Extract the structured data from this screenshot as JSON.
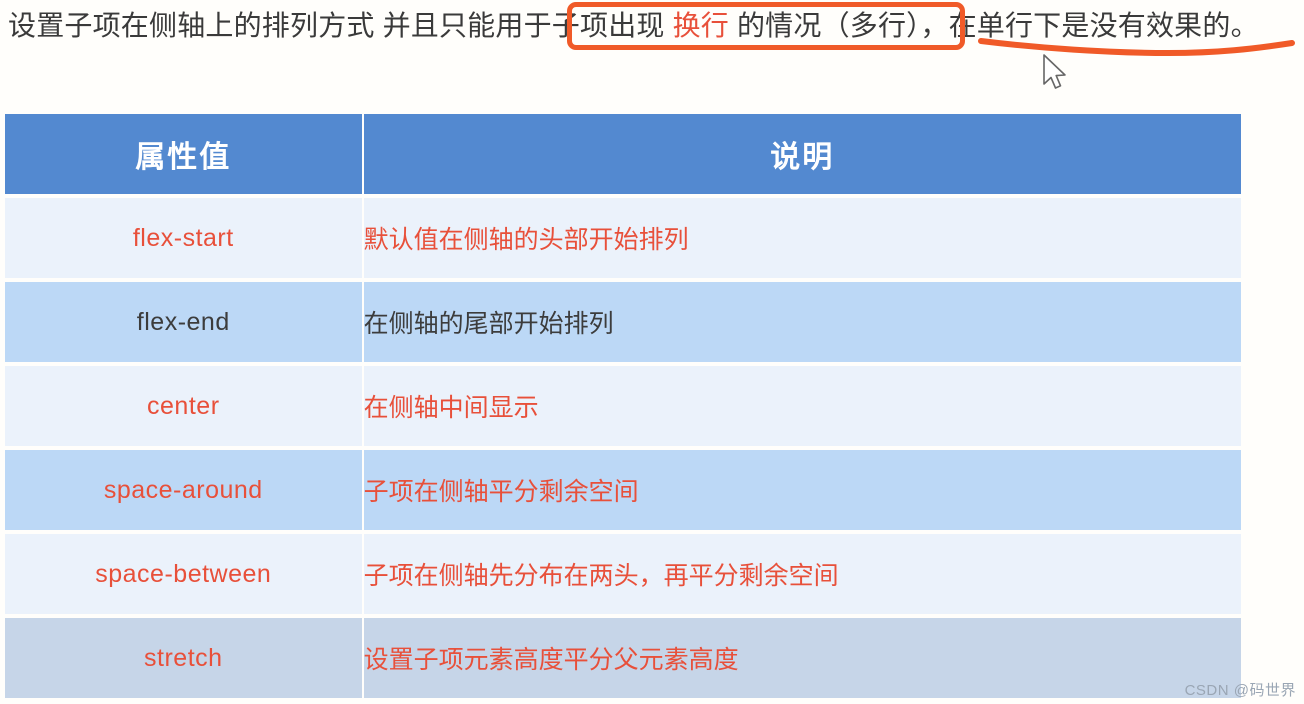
{
  "headline": {
    "part1": "设置子项在侧轴上的排列方式 并且只能用于",
    "boxed_pre": "子项出现 ",
    "boxed_red": "换行",
    "boxed_post": " 的情况（多行）",
    "part2": "，在单行下是没有效果的。"
  },
  "annotations": {
    "box_color": "#f05a28",
    "underline_color": "#f05a28",
    "cursor_name": "mouse-pointer"
  },
  "table": {
    "headers": {
      "value": "属性值",
      "description": "说明"
    },
    "header_bg": "#5389d0",
    "row_bg_light": "#ebf2fb",
    "row_bg_blue": "#bcd8f6",
    "row_bg_gray": "#c6d5e8",
    "text_red": "#e8503a",
    "text_dark": "#3c3c3c",
    "rows": [
      {
        "value": "flex-start",
        "description": "默认值在侧轴的头部开始排列",
        "value_color": "red",
        "desc_color": "red",
        "band": "light",
        "indented": false
      },
      {
        "value": "flex-end",
        "description": "在侧轴的尾部开始排列",
        "value_color": "dark",
        "desc_color": "dark",
        "band": "blue",
        "indented": false
      },
      {
        "value": "center",
        "description": "在侧轴中间显示",
        "value_color": "red",
        "desc_color": "red",
        "band": "light",
        "indented": false
      },
      {
        "value": "space-around",
        "description": "子项在侧轴平分剩余空间",
        "value_color": "red",
        "desc_color": "red",
        "band": "blue",
        "indented": true
      },
      {
        "value": "space-between",
        "description": "子项在侧轴先分布在两头，再平分剩余空间",
        "value_color": "red",
        "desc_color": "red",
        "band": "light",
        "indented": true
      },
      {
        "value": "stretch",
        "description": "设置子项元素高度平分父元素高度",
        "value_color": "red",
        "desc_color": "red",
        "band": "gray",
        "indented": false
      }
    ]
  },
  "watermark": "CSDN @码世界"
}
